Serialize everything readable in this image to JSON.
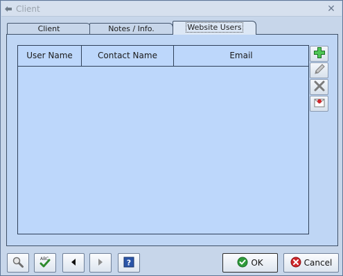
{
  "window": {
    "title": "Client"
  },
  "tabs": [
    {
      "label": "Client",
      "active": false
    },
    {
      "label": "Notes / Info.",
      "active": false
    },
    {
      "label": "Website Users",
      "active": true
    }
  ],
  "grid": {
    "columns": [
      "User Name",
      "Contact Name",
      "Email"
    ],
    "rows": []
  },
  "side_toolbar": {
    "icons": [
      "add-icon",
      "edit-icon",
      "delete-icon",
      "email-icon"
    ]
  },
  "footer": {
    "ok_label": "OK",
    "cancel_label": "Cancel",
    "icons": [
      "search-icon",
      "spellcheck-icon",
      "previous-icon",
      "next-icon",
      "help-icon"
    ]
  },
  "colors": {
    "panel": "#bfd6f5",
    "window": "#c7d6ea",
    "accent_green": "#2e8b2e",
    "accent_red": "#d0282c"
  }
}
